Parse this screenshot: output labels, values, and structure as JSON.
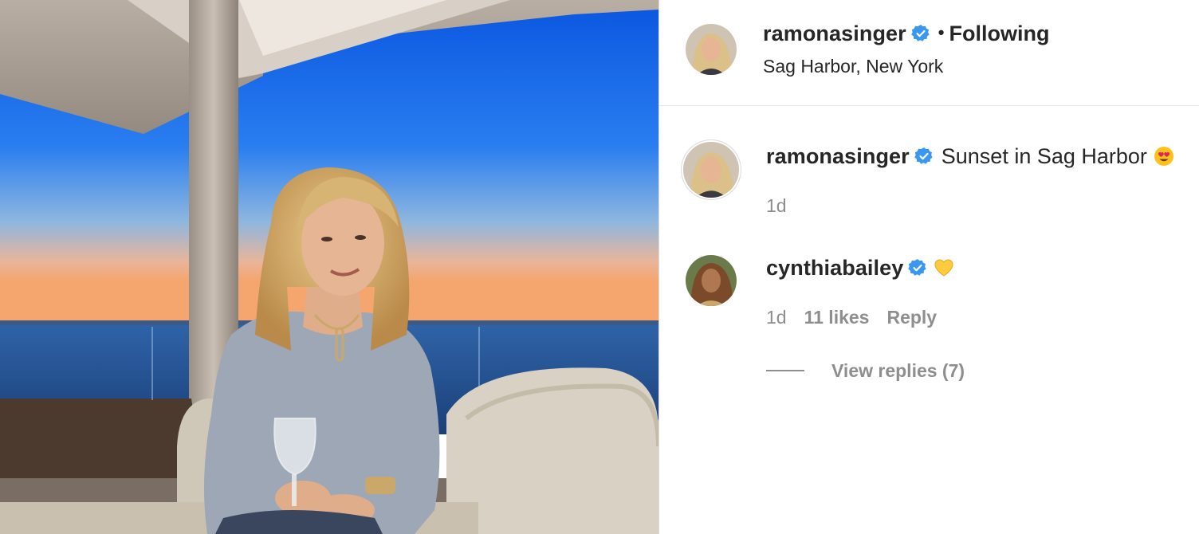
{
  "post": {
    "image_alt_icon": "post-photo",
    "colors": {
      "text": "#262626",
      "muted": "#8e8e8e",
      "verified": "#3897f0",
      "border": "#dbdbdb"
    }
  },
  "header": {
    "username": "ramonasinger",
    "separator": "•",
    "follow_status": "Following",
    "location": "Sag Harbor, New York",
    "verified_icon": "verified-badge-icon"
  },
  "comments": [
    {
      "username": "ramonasinger",
      "text": "Sunset in Sag Harbor",
      "emoji_icon": "heart-eyes-emoji",
      "time": "1d"
    },
    {
      "username": "cynthiabailey",
      "text": "",
      "emoji_icon": "yellow-heart-emoji",
      "time": "1d",
      "likes": "11 likes",
      "reply_label": "Reply",
      "view_replies": "View replies (7)"
    }
  ]
}
